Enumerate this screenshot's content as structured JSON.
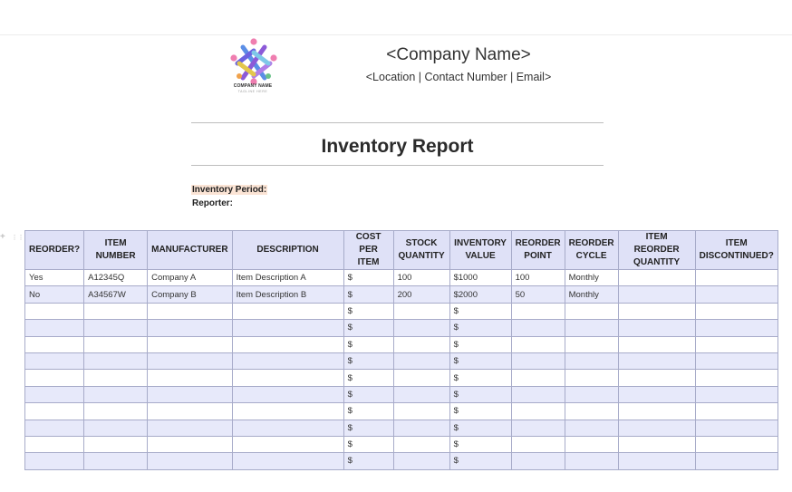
{
  "header": {
    "logo": {
      "icon": "people-circle-logo",
      "name": "COMPANY NAME",
      "tagline": "TAGLINE HERE"
    },
    "company_name": "<Company Name>",
    "contact_line": "<Location | Contact Number | Email>"
  },
  "report": {
    "title": "Inventory Report",
    "period_label": "Inventory Period:",
    "reporter_label": "Reporter:"
  },
  "table": {
    "columns": [
      {
        "label": "REORDER?"
      },
      {
        "label": "ITEM NUMBER"
      },
      {
        "label": "MANUFACTURER"
      },
      {
        "label": "DESCRIPTION"
      },
      {
        "label": "COST PER ITEM"
      },
      {
        "label": "STOCK QUANTITY"
      },
      {
        "label": "INVENTORY VALUE"
      },
      {
        "label": "REORDER POINT"
      },
      {
        "label": "REORDER CYCLE"
      },
      {
        "label": "ITEM REORDER QUANTITY"
      },
      {
        "label": "ITEM DISCONTINUED?"
      }
    ],
    "rows": [
      [
        "Yes",
        "A12345Q",
        "Company A",
        "Item Description A",
        "$",
        "100",
        "$1000",
        "100",
        "Monthly",
        "",
        ""
      ],
      [
        "No",
        "A34567W",
        "Company B",
        "Item Description B",
        "$",
        "200",
        "$2000",
        "50",
        "Monthly",
        "",
        ""
      ],
      [
        "",
        "",
        "",
        "",
        "$",
        "",
        "$",
        "",
        "",
        "",
        ""
      ],
      [
        "",
        "",
        "",
        "",
        "$",
        "",
        "$",
        "",
        "",
        "",
        ""
      ],
      [
        "",
        "",
        "",
        "",
        "$",
        "",
        "$",
        "",
        "",
        "",
        ""
      ],
      [
        "",
        "",
        "",
        "",
        "$",
        "",
        "$",
        "",
        "",
        "",
        ""
      ],
      [
        "",
        "",
        "",
        "",
        "$",
        "",
        "$",
        "",
        "",
        "",
        ""
      ],
      [
        "",
        "",
        "",
        "",
        "$",
        "",
        "$",
        "",
        "",
        "",
        ""
      ],
      [
        "",
        "",
        "",
        "",
        "$",
        "",
        "$",
        "",
        "",
        "",
        ""
      ],
      [
        "",
        "",
        "",
        "",
        "$",
        "",
        "$",
        "",
        "",
        "",
        ""
      ],
      [
        "",
        "",
        "",
        "",
        "$",
        "",
        "$",
        "",
        "",
        "",
        ""
      ],
      [
        "",
        "",
        "",
        "",
        "$",
        "",
        "$",
        "",
        "",
        "",
        ""
      ]
    ]
  },
  "gutter": {
    "add_icon": "plus-icon",
    "add_glyph": "+",
    "drag_icon": "drag-handle-icon",
    "drag_glyph": "⋮⋮"
  },
  "colors": {
    "header_bg": "#dfe1f7",
    "row_alt_bg": "#e7e9fa",
    "border": "#a7abc9",
    "highlight": "#fbe4d5"
  }
}
